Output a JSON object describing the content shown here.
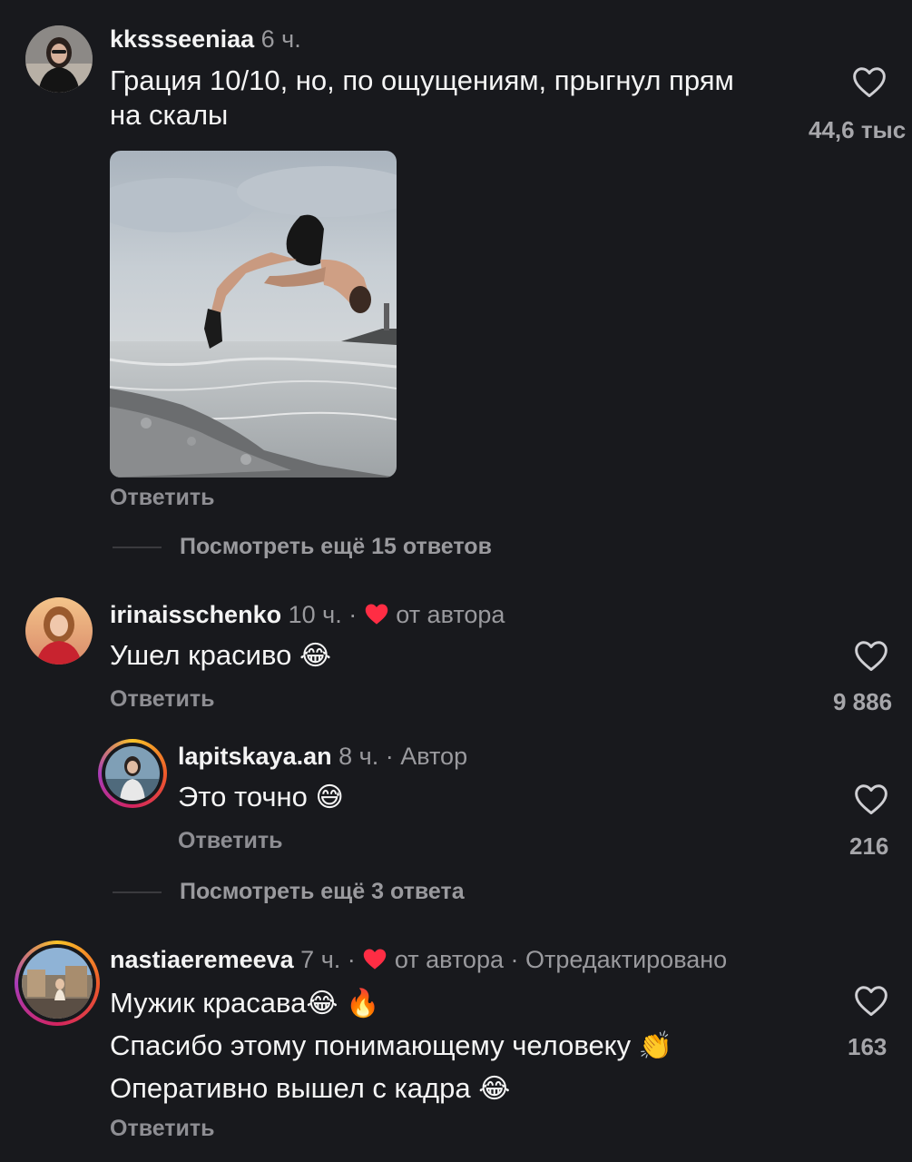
{
  "comments": [
    {
      "username": "kkssseeniaa",
      "time": "6 ч.",
      "text_line1": "Грация 10/10, но, по ощущениям, прыгнул прям",
      "text_line2": "на скалы",
      "likes": "44,6 тыс",
      "reply_label": "Ответить",
      "view_more": "Посмотреть ещё 15 ответов",
      "photo_icon": "cliff-dive-photo"
    },
    {
      "username": "irinaisschenko",
      "time": "10 ч.",
      "separator": "·",
      "author_like_label": "от автора",
      "text": "Ушел красиво",
      "emoji": "😂",
      "likes": "9 886",
      "reply_label": "Ответить",
      "reply": {
        "username": "lapitskaya.an",
        "time": "8 ч.",
        "separator": "·",
        "author_badge": "Автор",
        "text": "Это точно",
        "emoji": "😅",
        "likes": "216",
        "reply_label": "Ответить"
      },
      "view_more": "Посмотреть ещё 3 ответа"
    },
    {
      "username": "nastiaeremeeva",
      "time": "7 ч.",
      "separator": "·",
      "author_like_label": "от автора",
      "separator2": "·",
      "edited_label": "Отредактировано",
      "line1": "Мужик красава",
      "line1_emoji": "😂",
      "line1_emoji2": "🔥",
      "line2": "Спасибо этому понимающему человеку",
      "line2_emoji": "👏",
      "line3": "Оперативно вышел с кадра",
      "line3_emoji": "😂",
      "likes": "163",
      "reply_label": "Ответить"
    }
  ],
  "colors": {
    "background": "#18191d",
    "text": "#f3f3f3",
    "muted": "#9a9a9e",
    "author_heart": "#ff2d44"
  },
  "icons": {
    "like": "heart-outline-icon",
    "author_like": "heart-filled-icon"
  }
}
